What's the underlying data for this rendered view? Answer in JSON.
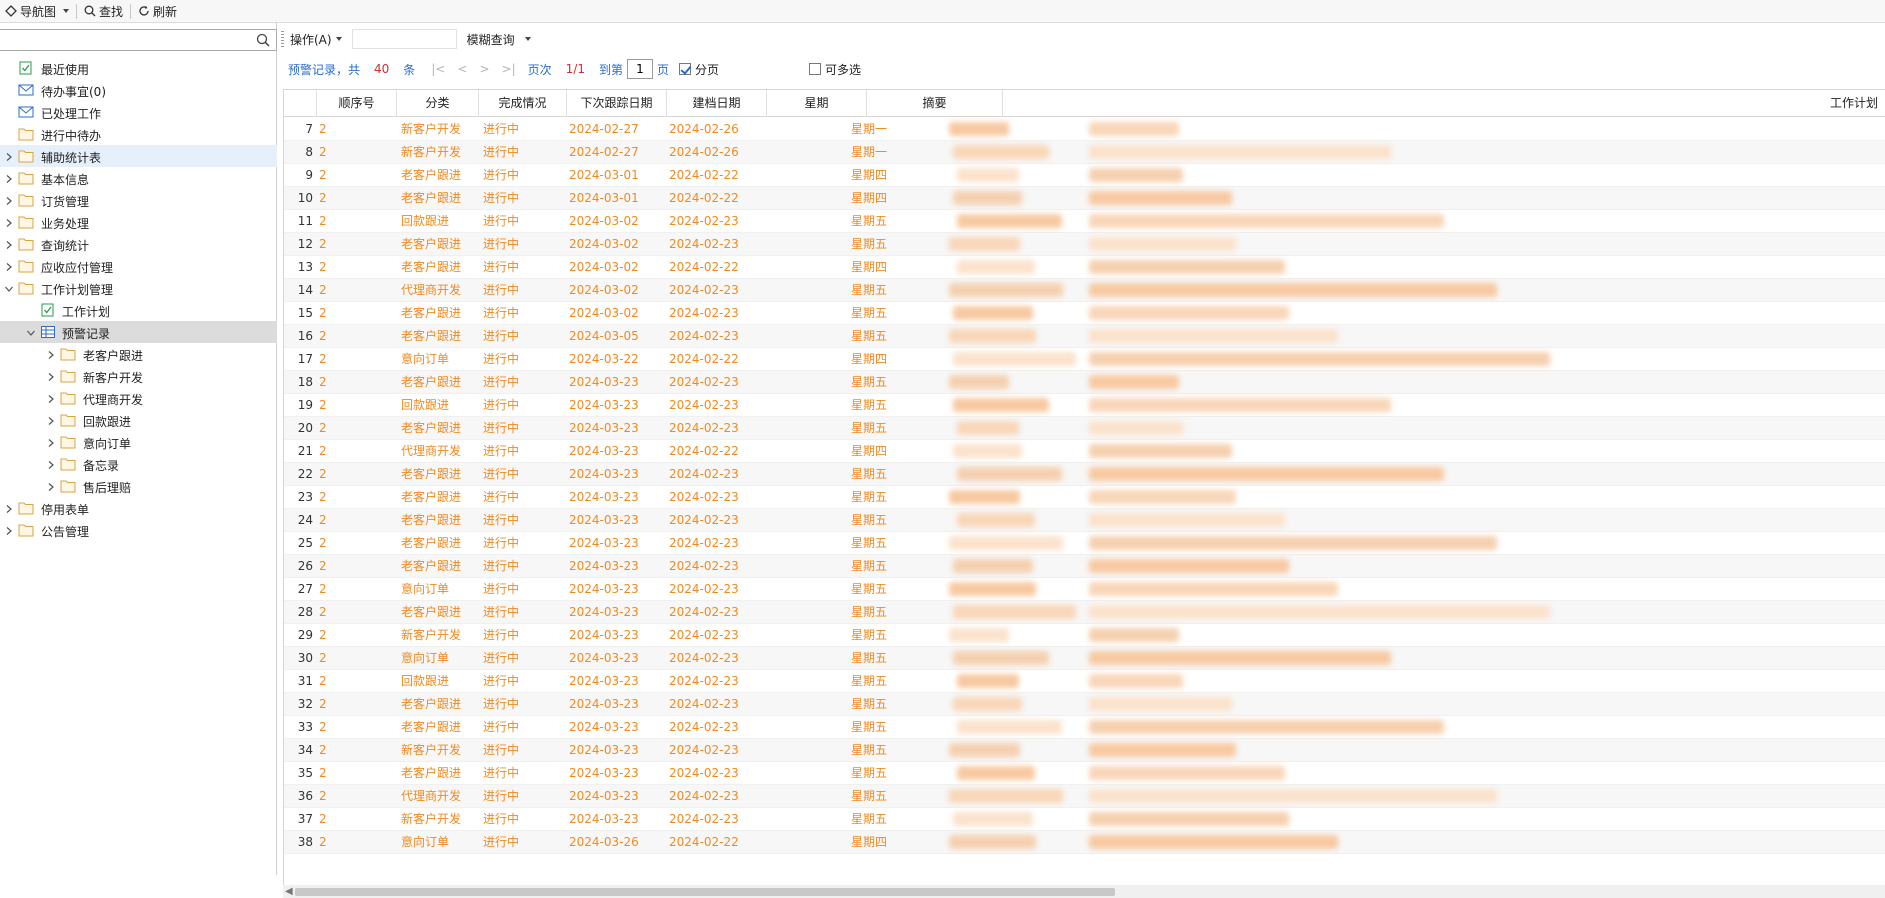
{
  "toolbar": {
    "nav_label": "导航图",
    "find_label": "查找",
    "refresh_label": "刷新"
  },
  "sidebar": {
    "search_placeholder": "",
    "items": [
      {
        "label": "最近使用",
        "icon": "edit-check-icon",
        "level": 0
      },
      {
        "label": "待办事宜(0)",
        "icon": "mail-icon",
        "level": 0
      },
      {
        "label": "已处理工作",
        "icon": "mail-icon",
        "level": 0
      },
      {
        "label": "进行中待办",
        "icon": "folder-icon",
        "level": 0
      },
      {
        "label": "辅助统计表",
        "icon": "folder-icon",
        "level": 0,
        "expandable": true
      },
      {
        "label": "基本信息",
        "icon": "folder-icon",
        "level": 0,
        "expandable": true
      },
      {
        "label": "订货管理",
        "icon": "folder-icon",
        "level": 0,
        "expandable": true
      },
      {
        "label": "业务处理",
        "icon": "folder-icon",
        "level": 0,
        "expandable": true
      },
      {
        "label": "查询统计",
        "icon": "folder-icon",
        "level": 0,
        "expandable": true
      },
      {
        "label": "应收应付管理",
        "icon": "folder-icon",
        "level": 0,
        "expandable": true
      },
      {
        "label": "工作计划管理",
        "icon": "folder-icon",
        "level": 0,
        "expandable": true,
        "expanded": true
      },
      {
        "label": "工作计划",
        "icon": "edit-check-icon",
        "level": 1
      },
      {
        "label": "预警记录",
        "icon": "table-icon",
        "level": 1,
        "expandable": true,
        "expanded": true
      },
      {
        "label": "老客户跟进",
        "icon": "folder-icon",
        "level": 2,
        "expandable": true
      },
      {
        "label": "新客户开发",
        "icon": "folder-icon",
        "level": 2,
        "expandable": true
      },
      {
        "label": "代理商开发",
        "icon": "folder-icon",
        "level": 2,
        "expandable": true
      },
      {
        "label": "回款跟进",
        "icon": "folder-icon",
        "level": 2,
        "expandable": true
      },
      {
        "label": "意向订单",
        "icon": "folder-icon",
        "level": 2,
        "expandable": true
      },
      {
        "label": "备忘录",
        "icon": "folder-icon",
        "level": 2,
        "expandable": true
      },
      {
        "label": "售后理赔",
        "icon": "folder-icon",
        "level": 2,
        "expandable": true
      },
      {
        "label": "停用表单",
        "icon": "folder-icon",
        "level": 0,
        "expandable": true
      },
      {
        "label": "公告管理",
        "icon": "folder-icon",
        "level": 0,
        "expandable": true
      }
    ]
  },
  "query": {
    "action_label": "操作(A)",
    "fuzzy_label": "模糊查询"
  },
  "pager": {
    "title": "预警记录，共",
    "total": "40",
    "unit": "条",
    "first": "|<",
    "prev": "<",
    "next": ">",
    "last": ">|",
    "page_label": "页次",
    "page_value": "1/1",
    "goto_label": "到第",
    "goto_value": "1",
    "page_unit": "页",
    "paging_label": "分页",
    "multi_label": "可多选"
  },
  "colors": {
    "accent_orange": "#f08a20",
    "link_blue": "#2a6bd1",
    "count_red": "#d03030"
  },
  "table": {
    "columns": [
      "",
      "顺序号",
      "分类",
      "完成情况",
      "下次跟踪日期",
      "建档日期",
      "星期",
      "摘要",
      "工作计划"
    ],
    "rows": [
      {
        "n": "7",
        "seq": "2",
        "cat": "新客户开发",
        "status": "进行中",
        "next": "2024-02-27",
        "created": "2024-02-26",
        "week": "星期一"
      },
      {
        "n": "8",
        "seq": "2",
        "cat": "新客户开发",
        "status": "进行中",
        "next": "2024-02-27",
        "created": "2024-02-26",
        "week": "星期一"
      },
      {
        "n": "9",
        "seq": "2",
        "cat": "老客户跟进",
        "status": "进行中",
        "next": "2024-03-01",
        "created": "2024-02-22",
        "week": "星期四"
      },
      {
        "n": "10",
        "seq": "2",
        "cat": "老客户跟进",
        "status": "进行中",
        "next": "2024-03-01",
        "created": "2024-02-22",
        "week": "星期四"
      },
      {
        "n": "11",
        "seq": "2",
        "cat": "回款跟进",
        "status": "进行中",
        "next": "2024-03-02",
        "created": "2024-02-23",
        "week": "星期五"
      },
      {
        "n": "12",
        "seq": "2",
        "cat": "老客户跟进",
        "status": "进行中",
        "next": "2024-03-02",
        "created": "2024-02-23",
        "week": "星期五"
      },
      {
        "n": "13",
        "seq": "2",
        "cat": "老客户跟进",
        "status": "进行中",
        "next": "2024-03-02",
        "created": "2024-02-22",
        "week": "星期四"
      },
      {
        "n": "14",
        "seq": "2",
        "cat": "代理商开发",
        "status": "进行中",
        "next": "2024-03-02",
        "created": "2024-02-23",
        "week": "星期五"
      },
      {
        "n": "15",
        "seq": "2",
        "cat": "老客户跟进",
        "status": "进行中",
        "next": "2024-03-02",
        "created": "2024-02-23",
        "week": "星期五"
      },
      {
        "n": "16",
        "seq": "2",
        "cat": "老客户跟进",
        "status": "进行中",
        "next": "2024-03-05",
        "created": "2024-02-23",
        "week": "星期五"
      },
      {
        "n": "17",
        "seq": "2",
        "cat": "意向订单",
        "status": "进行中",
        "next": "2024-03-22",
        "created": "2024-02-22",
        "week": "星期四"
      },
      {
        "n": "18",
        "seq": "2",
        "cat": "老客户跟进",
        "status": "进行中",
        "next": "2024-03-23",
        "created": "2024-02-23",
        "week": "星期五"
      },
      {
        "n": "19",
        "seq": "2",
        "cat": "回款跟进",
        "status": "进行中",
        "next": "2024-03-23",
        "created": "2024-02-23",
        "week": "星期五"
      },
      {
        "n": "20",
        "seq": "2",
        "cat": "老客户跟进",
        "status": "进行中",
        "next": "2024-03-23",
        "created": "2024-02-23",
        "week": "星期五"
      },
      {
        "n": "21",
        "seq": "2",
        "cat": "代理商开发",
        "status": "进行中",
        "next": "2024-03-23",
        "created": "2024-02-22",
        "week": "星期四"
      },
      {
        "n": "22",
        "seq": "2",
        "cat": "老客户跟进",
        "status": "进行中",
        "next": "2024-03-23",
        "created": "2024-02-23",
        "week": "星期五"
      },
      {
        "n": "23",
        "seq": "2",
        "cat": "老客户跟进",
        "status": "进行中",
        "next": "2024-03-23",
        "created": "2024-02-23",
        "week": "星期五"
      },
      {
        "n": "24",
        "seq": "2",
        "cat": "老客户跟进",
        "status": "进行中",
        "next": "2024-03-23",
        "created": "2024-02-23",
        "week": "星期五"
      },
      {
        "n": "25",
        "seq": "2",
        "cat": "老客户跟进",
        "status": "进行中",
        "next": "2024-03-23",
        "created": "2024-02-23",
        "week": "星期五"
      },
      {
        "n": "26",
        "seq": "2",
        "cat": "老客户跟进",
        "status": "进行中",
        "next": "2024-03-23",
        "created": "2024-02-23",
        "week": "星期五"
      },
      {
        "n": "27",
        "seq": "2",
        "cat": "意向订单",
        "status": "进行中",
        "next": "2024-03-23",
        "created": "2024-02-23",
        "week": "星期五"
      },
      {
        "n": "28",
        "seq": "2",
        "cat": "老客户跟进",
        "status": "进行中",
        "next": "2024-03-23",
        "created": "2024-02-23",
        "week": "星期五"
      },
      {
        "n": "29",
        "seq": "2",
        "cat": "新客户开发",
        "status": "进行中",
        "next": "2024-03-23",
        "created": "2024-02-23",
        "week": "星期五"
      },
      {
        "n": "30",
        "seq": "2",
        "cat": "意向订单",
        "status": "进行中",
        "next": "2024-03-23",
        "created": "2024-02-23",
        "week": "星期五"
      },
      {
        "n": "31",
        "seq": "2",
        "cat": "回款跟进",
        "status": "进行中",
        "next": "2024-03-23",
        "created": "2024-02-23",
        "week": "星期五"
      },
      {
        "n": "32",
        "seq": "2",
        "cat": "老客户跟进",
        "status": "进行中",
        "next": "2024-03-23",
        "created": "2024-02-23",
        "week": "星期五"
      },
      {
        "n": "33",
        "seq": "2",
        "cat": "老客户跟进",
        "status": "进行中",
        "next": "2024-03-23",
        "created": "2024-02-23",
        "week": "星期五"
      },
      {
        "n": "34",
        "seq": "2",
        "cat": "新客户开发",
        "status": "进行中",
        "next": "2024-03-23",
        "created": "2024-02-23",
        "week": "星期五"
      },
      {
        "n": "35",
        "seq": "2",
        "cat": "老客户跟进",
        "status": "进行中",
        "next": "2024-03-23",
        "created": "2024-02-23",
        "week": "星期五"
      },
      {
        "n": "36",
        "seq": "2",
        "cat": "代理商开发",
        "status": "进行中",
        "next": "2024-03-23",
        "created": "2024-02-23",
        "week": "星期五"
      },
      {
        "n": "37",
        "seq": "2",
        "cat": "新客户开发",
        "status": "进行中",
        "next": "2024-03-23",
        "created": "2024-02-23",
        "week": "星期五"
      },
      {
        "n": "38",
        "seq": "2",
        "cat": "意向订单",
        "status": "进行中",
        "next": "2024-03-26",
        "created": "2024-02-22",
        "week": "星期四"
      }
    ]
  }
}
